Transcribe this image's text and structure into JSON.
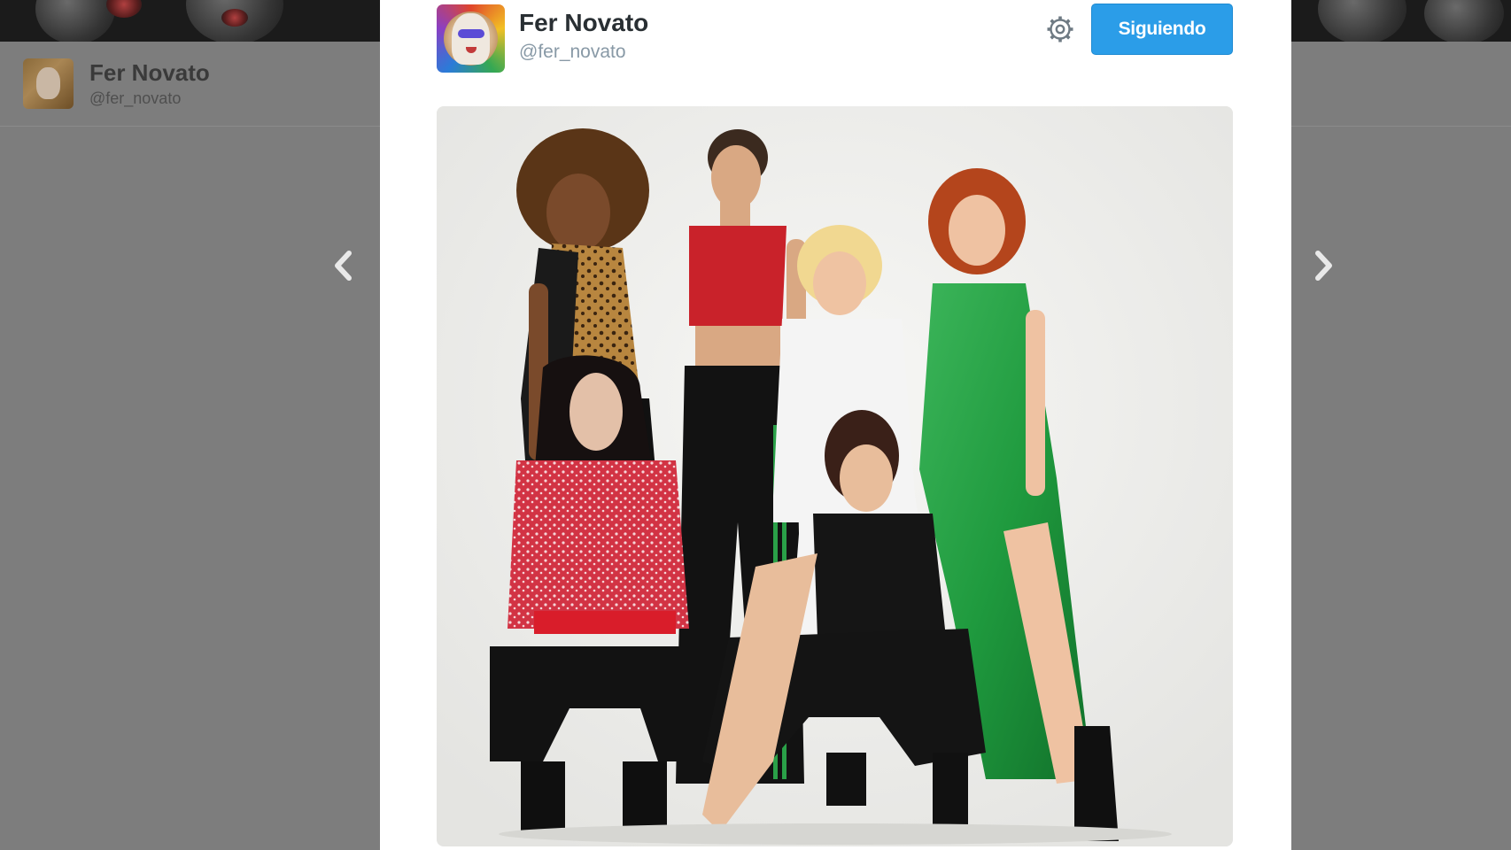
{
  "background": {
    "profile_name": "Fer Novato",
    "profile_handle": "@fer_novato",
    "prev_arrow_icon": "chevron-left-icon",
    "next_arrow_icon": "chevron-right-icon"
  },
  "tweet": {
    "author_name": "Fer Novato",
    "author_handle": "@fer_novato",
    "settings_icon": "gear-icon",
    "follow_label": "Siguiendo",
    "follow_color": "#2b9de8",
    "photo_alt": "Photo"
  }
}
